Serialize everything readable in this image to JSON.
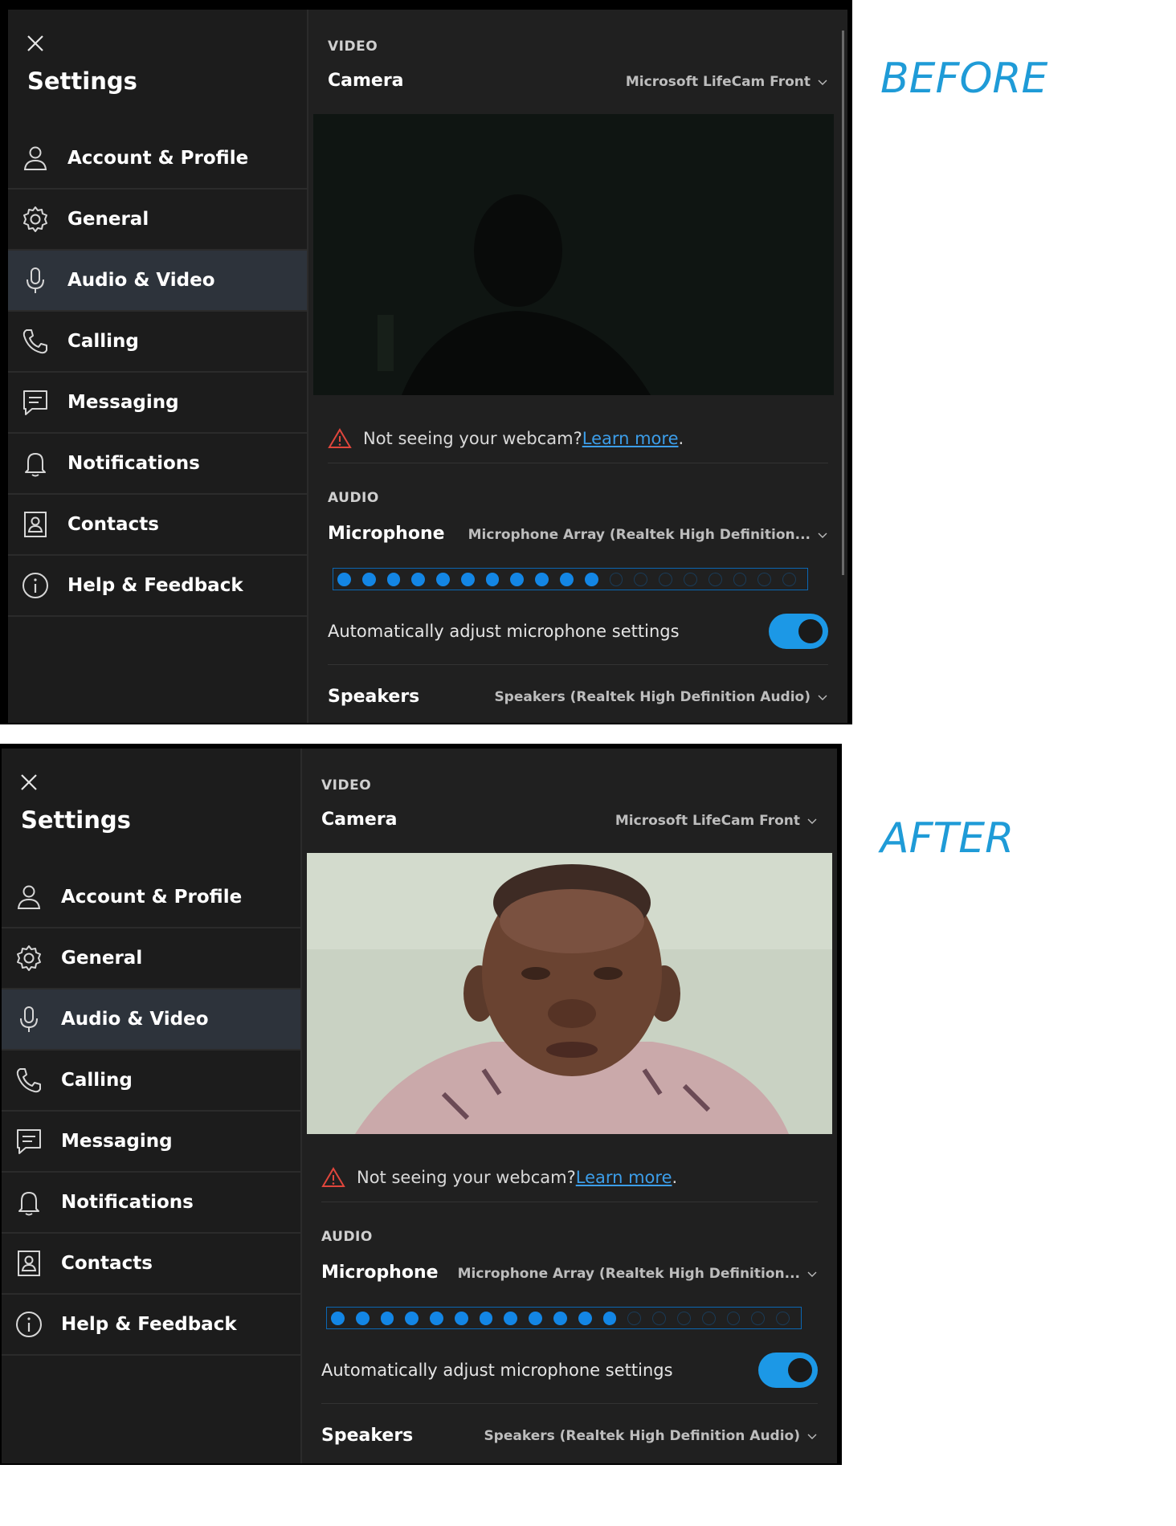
{
  "labels": {
    "before": "BEFORE",
    "after": "AFTER"
  },
  "settings": {
    "title": "Settings",
    "nav": [
      {
        "label": "Account & Profile",
        "icon": "person-icon"
      },
      {
        "label": "General",
        "icon": "gear-icon"
      },
      {
        "label": "Audio & Video",
        "icon": "microphone-icon",
        "active": true
      },
      {
        "label": "Calling",
        "icon": "phone-icon"
      },
      {
        "label": "Messaging",
        "icon": "message-icon"
      },
      {
        "label": "Notifications",
        "icon": "bell-icon"
      },
      {
        "label": "Contacts",
        "icon": "contacts-icon"
      },
      {
        "label": "Help & Feedback",
        "icon": "info-icon"
      }
    ]
  },
  "video": {
    "section": "VIDEO",
    "camera_label": "Camera",
    "camera_value": "Microsoft LifeCam Front"
  },
  "webcam_help": {
    "text": "Not seeing your webcam? ",
    "link": "Learn more",
    "suffix": "."
  },
  "audio": {
    "section": "AUDIO",
    "microphone_label": "Microphone",
    "microphone_value": "Microphone Array (Realtek High Definition...",
    "mic_level_total": 19,
    "mic_level_before": 11,
    "mic_level_after": 12,
    "auto_adjust_label": "Automatically adjust microphone settings",
    "auto_adjust_on": true,
    "speakers_label": "Speakers",
    "speakers_value": "Speakers (Realtek High Definition Audio)"
  },
  "colors": {
    "accent": "#1386e5",
    "toggle": "#1c98e6",
    "link": "#3c9de8",
    "tag": "#1f9bd7",
    "warning": "#e0463c"
  }
}
